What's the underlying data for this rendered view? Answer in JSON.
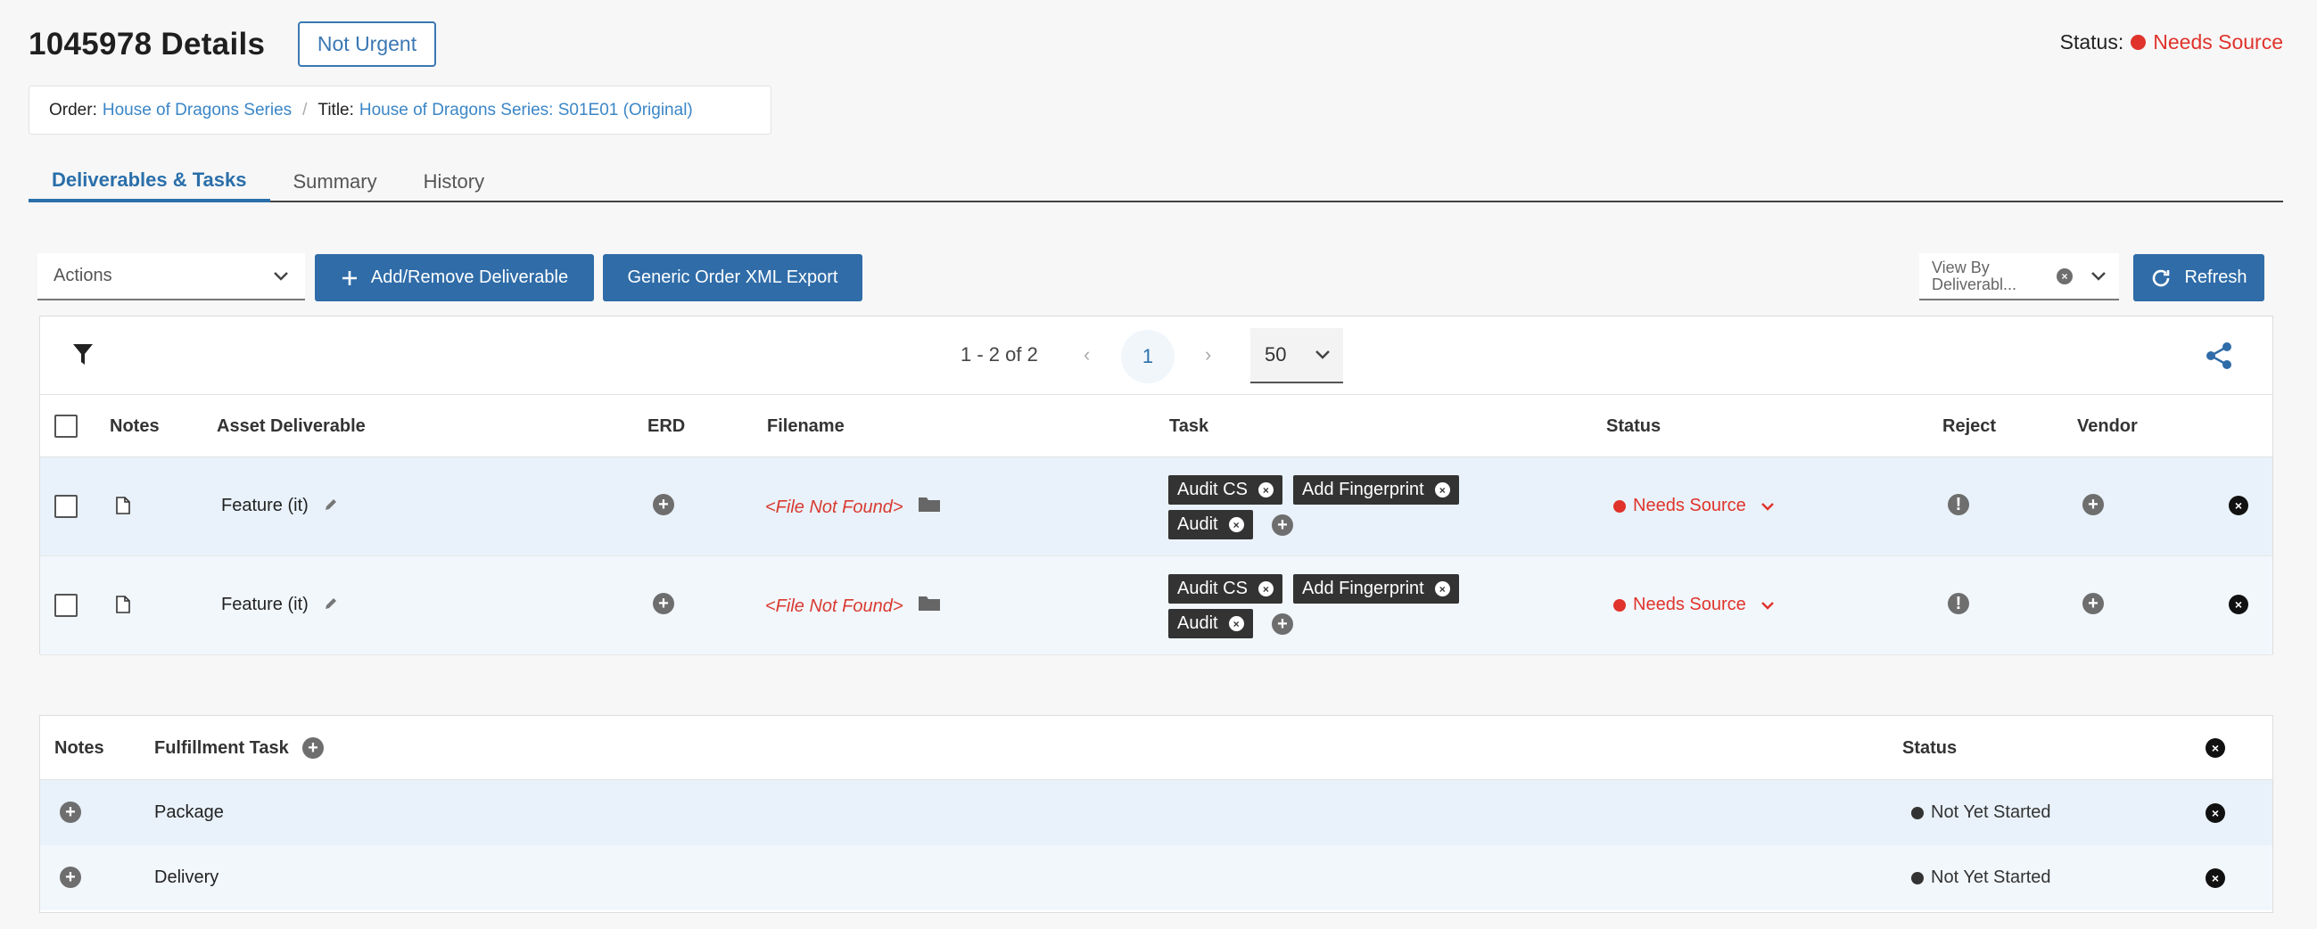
{
  "header": {
    "title": "1045978 Details",
    "urgency": "Not Urgent",
    "status_label": "Status:",
    "status_value": "Needs Source",
    "status_color": "#e0332b"
  },
  "breadcrumb": {
    "order_label": "Order:",
    "order_value": "House of Dragons Series",
    "separator": "/",
    "title_label": "Title:",
    "title_value": "House of Dragons Series: S01E01 (Original)"
  },
  "tabs": [
    {
      "label": "Deliverables & Tasks",
      "active": true
    },
    {
      "label": "Summary",
      "active": false
    },
    {
      "label": "History",
      "active": false
    }
  ],
  "toolbar": {
    "actions_placeholder": "Actions",
    "add_remove_label": "Add/Remove Deliverable",
    "xml_export_label": "Generic Order XML Export",
    "view_by_line1": "View By",
    "view_by_line2": "Deliverabl...",
    "refresh_label": "Refresh"
  },
  "pagination": {
    "range": "1 - 2 of 2",
    "prev": "‹",
    "current_page": "1",
    "next": "›",
    "per_page": "50"
  },
  "deliverables_table": {
    "columns": [
      "Notes",
      "Asset Deliverable",
      "ERD",
      "Filename",
      "Task",
      "Status",
      "Reject",
      "Vendor"
    ],
    "rows": [
      {
        "asset": "Feature (it)",
        "filename": "<File Not Found>",
        "tasks": [
          "Audit CS",
          "Add Fingerprint",
          "Audit"
        ],
        "status": "Needs Source"
      },
      {
        "asset": "Feature (it)",
        "filename": "<File Not Found>",
        "tasks": [
          "Audit CS",
          "Add Fingerprint",
          "Audit"
        ],
        "status": "Needs Source"
      }
    ]
  },
  "fulfillment_table": {
    "columns": {
      "notes": "Notes",
      "task": "Fulfillment Task",
      "status": "Status"
    },
    "rows": [
      {
        "task": "Package",
        "status": "Not Yet Started"
      },
      {
        "task": "Delivery",
        "status": "Not Yet Started"
      }
    ]
  },
  "colors": {
    "primary": "#2f6ca8",
    "link": "#3b86c7",
    "danger": "#e0332b"
  },
  "icons": {
    "filter": "filter-icon",
    "share": "share-icon",
    "note": "document-icon",
    "edit": "pencil-icon",
    "folder": "folder-icon",
    "add": "plus-circle-icon",
    "reject": "exclamation-circle-icon",
    "remove": "close-circle-icon",
    "refresh": "refresh-icon"
  }
}
